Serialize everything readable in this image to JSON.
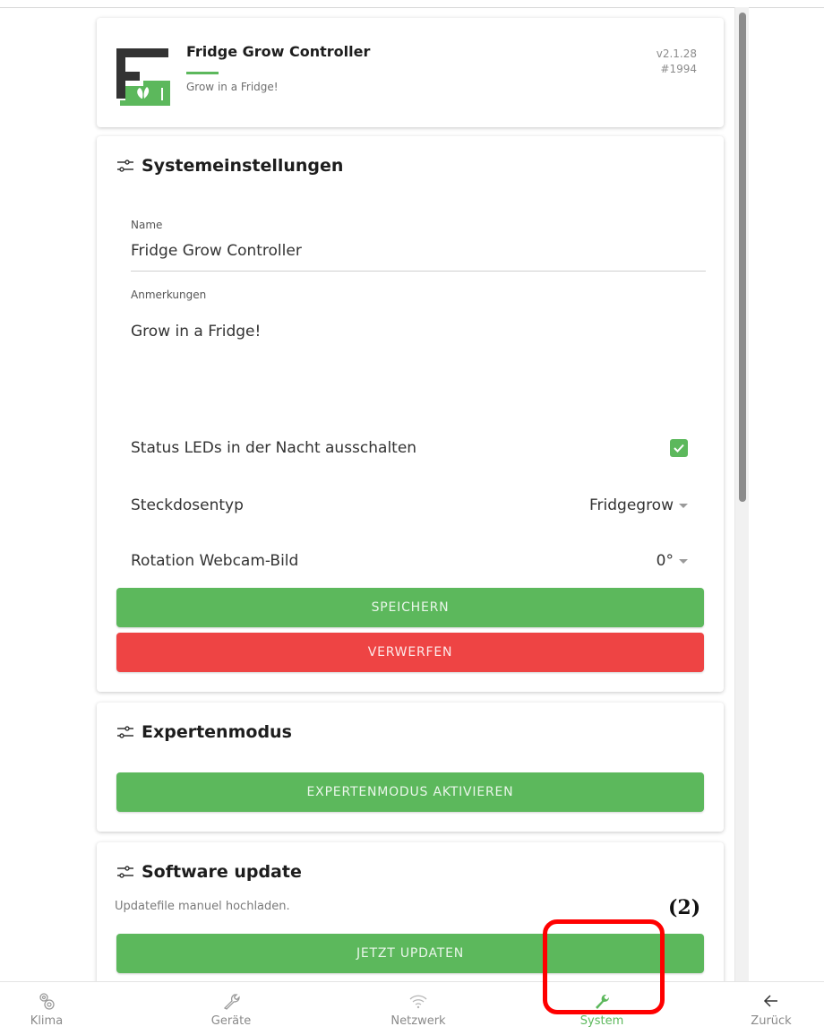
{
  "header": {
    "title": "Fridge Grow Controller",
    "subtitle": "Grow in a Fridge!",
    "version": "v2.1.28",
    "build": "#1994",
    "logo_icon": "fg-logo-icon"
  },
  "system_settings": {
    "title": "Systemeinstellungen",
    "name_label": "Name",
    "name_value": "Fridge Grow Controller",
    "notes_label": "Anmerkungen",
    "notes_value": "Grow in a Fridge!",
    "status_led_label": "Status LEDs in der Nacht ausschalten",
    "status_led_checked": true,
    "socket_type_label": "Steckdosentyp",
    "socket_type_value": "Fridgegrow",
    "rotation_label": "Rotation Webcam-Bild",
    "rotation_value": "0°",
    "save_label": "SPEICHERN",
    "discard_label": "VERWERFEN"
  },
  "expert_mode": {
    "title": "Expertenmodus",
    "activate_label": "EXPERTENMODUS AKTIVIEREN"
  },
  "software_update": {
    "title": "Software update",
    "note": "Updatefile manuel hochladen.",
    "update_label": "JETZT UPDATEN"
  },
  "annotation": {
    "label": "(2)"
  },
  "bottom_nav": {
    "items": [
      {
        "label": "Klima",
        "icon": "gears-icon"
      },
      {
        "label": "Geräte",
        "icon": "wrench-outline-icon"
      },
      {
        "label": "Netzwerk",
        "icon": "wifi-icon"
      },
      {
        "label": "System",
        "icon": "wrench-icon",
        "active": true
      },
      {
        "label": "Zurück",
        "icon": "arrow-left-icon"
      }
    ]
  },
  "colors": {
    "green": "#5cb85c",
    "red": "#ee4444",
    "annotation": "#ff0000"
  }
}
